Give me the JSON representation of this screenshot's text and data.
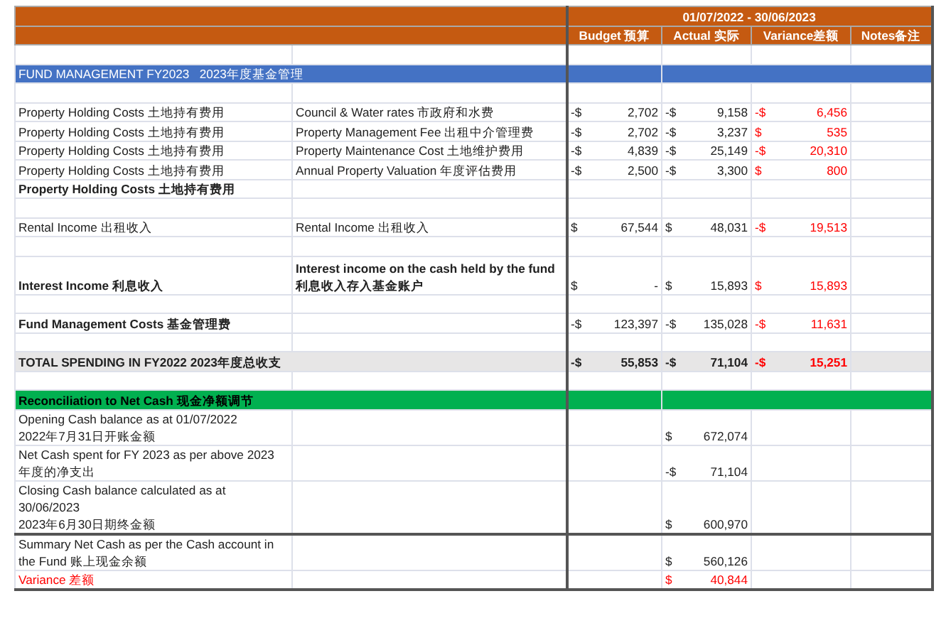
{
  "header": {
    "period": "01/07/2022 - 30/06/2023",
    "columns": [
      "Budget 预算",
      "Actual 实际",
      "Variance差额",
      "Notes备注"
    ]
  },
  "rows": [
    {
      "kind": "blank"
    },
    {
      "kind": "section",
      "label": "FUND MANAGEMENT FY2023   2023年度基金管理",
      "color": "#4472c4"
    },
    {
      "kind": "blank"
    },
    {
      "kind": "item",
      "category": "Property Holding Costs 土地持有费用",
      "description": "Council & Water rates 市政府和水费",
      "budget": {
        "currency": "-$",
        "amount": "2,702"
      },
      "actual": {
        "currency": "-$",
        "amount": "9,158"
      },
      "variance": {
        "currency": "-$",
        "amount": "6,456"
      }
    },
    {
      "kind": "item",
      "category": "Property Holding Costs 土地持有费用",
      "description": "Property Management Fee 出租中介管理费",
      "budget": {
        "currency": "-$",
        "amount": "2,702"
      },
      "actual": {
        "currency": "-$",
        "amount": "3,237"
      },
      "variance": {
        "currency": "$",
        "amount": "535"
      }
    },
    {
      "kind": "item",
      "category": "Property Holding Costs 土地持有费用",
      "description": "Property Maintenance Cost 土地维护费用",
      "budget": {
        "currency": "-$",
        "amount": "4,839"
      },
      "actual": {
        "currency": "-$",
        "amount": "25,149"
      },
      "variance": {
        "currency": "-$",
        "amount": "20,310"
      }
    },
    {
      "kind": "item",
      "category": "Property Holding Costs 土地持有费用",
      "description": "Annual Property Valuation 年度评估费用",
      "budget": {
        "currency": "-$",
        "amount": "2,500"
      },
      "actual": {
        "currency": "-$",
        "amount": "3,300"
      },
      "variance": {
        "currency": "$",
        "amount": "800"
      }
    },
    {
      "kind": "item",
      "category": "Property Holding Costs 土地持有费用",
      "bold": true
    },
    {
      "kind": "blank"
    },
    {
      "kind": "item",
      "category": "Rental Income 出租收入",
      "description": "Rental Income 出租收入",
      "budget": {
        "currency": "$",
        "amount": "67,544"
      },
      "actual": {
        "currency": "$",
        "amount": "48,031"
      },
      "variance": {
        "currency": "-$",
        "amount": "19,513"
      }
    },
    {
      "kind": "blank"
    },
    {
      "kind": "item",
      "category": "Interest Income 利息收入",
      "description": "Interest income on the cash held by the fund 利息收入存入基金账户",
      "bold": true,
      "tall": true,
      "budget": {
        "currency": "$",
        "amount": "-"
      },
      "actual": {
        "currency": "$",
        "amount": "15,893"
      },
      "variance": {
        "currency": "$",
        "amount": "15,893"
      }
    },
    {
      "kind": "blank"
    },
    {
      "kind": "item",
      "category": "Fund Management Costs 基金管理费",
      "bold": true,
      "budget": {
        "currency": "-$",
        "amount": "123,397"
      },
      "actual": {
        "currency": "-$",
        "amount": "135,028"
      },
      "variance": {
        "currency": "-$",
        "amount": "11,631"
      }
    },
    {
      "kind": "blank"
    },
    {
      "kind": "total",
      "category": "TOTAL SPENDING IN FY2022  2023年度总收支",
      "budget": {
        "currency": "-$",
        "amount": "55,853"
      },
      "actual": {
        "currency": "-$",
        "amount": "71,104"
      },
      "variance": {
        "currency": "-$",
        "amount": "15,251"
      }
    },
    {
      "kind": "blank"
    },
    {
      "kind": "section",
      "label": "Reconciliation to Net Cash 现金净额调节",
      "color": "#00b050"
    },
    {
      "kind": "recon",
      "label": "Opening Cash balance as at 01/07/2022\n2022年7月31日开账金额",
      "actual": {
        "currency": "$",
        "amount": "672,074"
      }
    },
    {
      "kind": "recon",
      "label": "Net Cash spent for FY 2023 as per above 2023\n年度的净支出",
      "actual": {
        "currency": "-$",
        "amount": "71,104"
      }
    },
    {
      "kind": "recon",
      "label": "Closing Cash balance calculated as at\n30/06/2023\n2023年6月30日期终金额",
      "actual": {
        "currency": "$",
        "amount": "600,970"
      }
    },
    {
      "kind": "recon",
      "label": "Summary Net Cash as per the Cash account in\nthe Fund        账上现金余额",
      "rule": true,
      "actual": {
        "currency": "$",
        "amount": "560,126"
      }
    },
    {
      "kind": "recon",
      "label": "Variance 差额",
      "alert": true,
      "actual": {
        "currency": "$",
        "amount": "40,844"
      }
    }
  ]
}
